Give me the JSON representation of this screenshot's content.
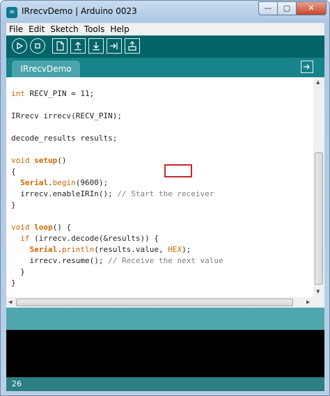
{
  "window": {
    "title": "IRrecvDemo | Arduino 0023",
    "app_icon": "∞",
    "buttons": {
      "minimize": "—",
      "maximize": "▢",
      "close": "✕"
    }
  },
  "menu": [
    "File",
    "Edit",
    "Sketch",
    "Tools",
    "Help"
  ],
  "toolbar": {
    "icons": [
      "verify-icon",
      "stop-icon",
      "new-icon",
      "open-icon",
      "save-icon",
      "upload-icon",
      "serial-monitor-icon"
    ]
  },
  "tab": {
    "label": "IRrecvDemo"
  },
  "code": {
    "l1a": "int",
    "l1b": " RECV_PIN = 11;",
    "l2": "IRrecv irrecv(RECV_PIN);",
    "l3": "decode_results results;",
    "l4a": "void",
    "l4b": "setup",
    "l4c": "()",
    "l5": "{",
    "l6a": "  ",
    "l6b": "Serial",
    "l6c": ".",
    "l6d": "begin",
    "l6e": "(9600);",
    "l7a": "  irrecv.enableIRIn(); ",
    "l7b": "// Start the receiver",
    "l8": "}",
    "l9a": "void",
    "l9b": "loop",
    "l9c": "() {",
    "l10a": "  ",
    "l10b": "if",
    "l10c": " (irrecv.decode(&results)) {",
    "l11a": "    ",
    "l11b": "Serial",
    "l11c": ".",
    "l11d": "println",
    "l11e": "(results.value, ",
    "l11f": "HEX",
    "l11g": ");",
    "l12a": "    irrecv.resume(); ",
    "l12b": "// Receive the next value",
    "l13": "  }",
    "l14": "}"
  },
  "status": {
    "line_number": "26"
  },
  "colors": {
    "toolbar": "#006468",
    "tabstrip": "#17838a",
    "keyword": "#cc6600",
    "comment": "#7e7e7e",
    "highlight": "#c0282f"
  }
}
